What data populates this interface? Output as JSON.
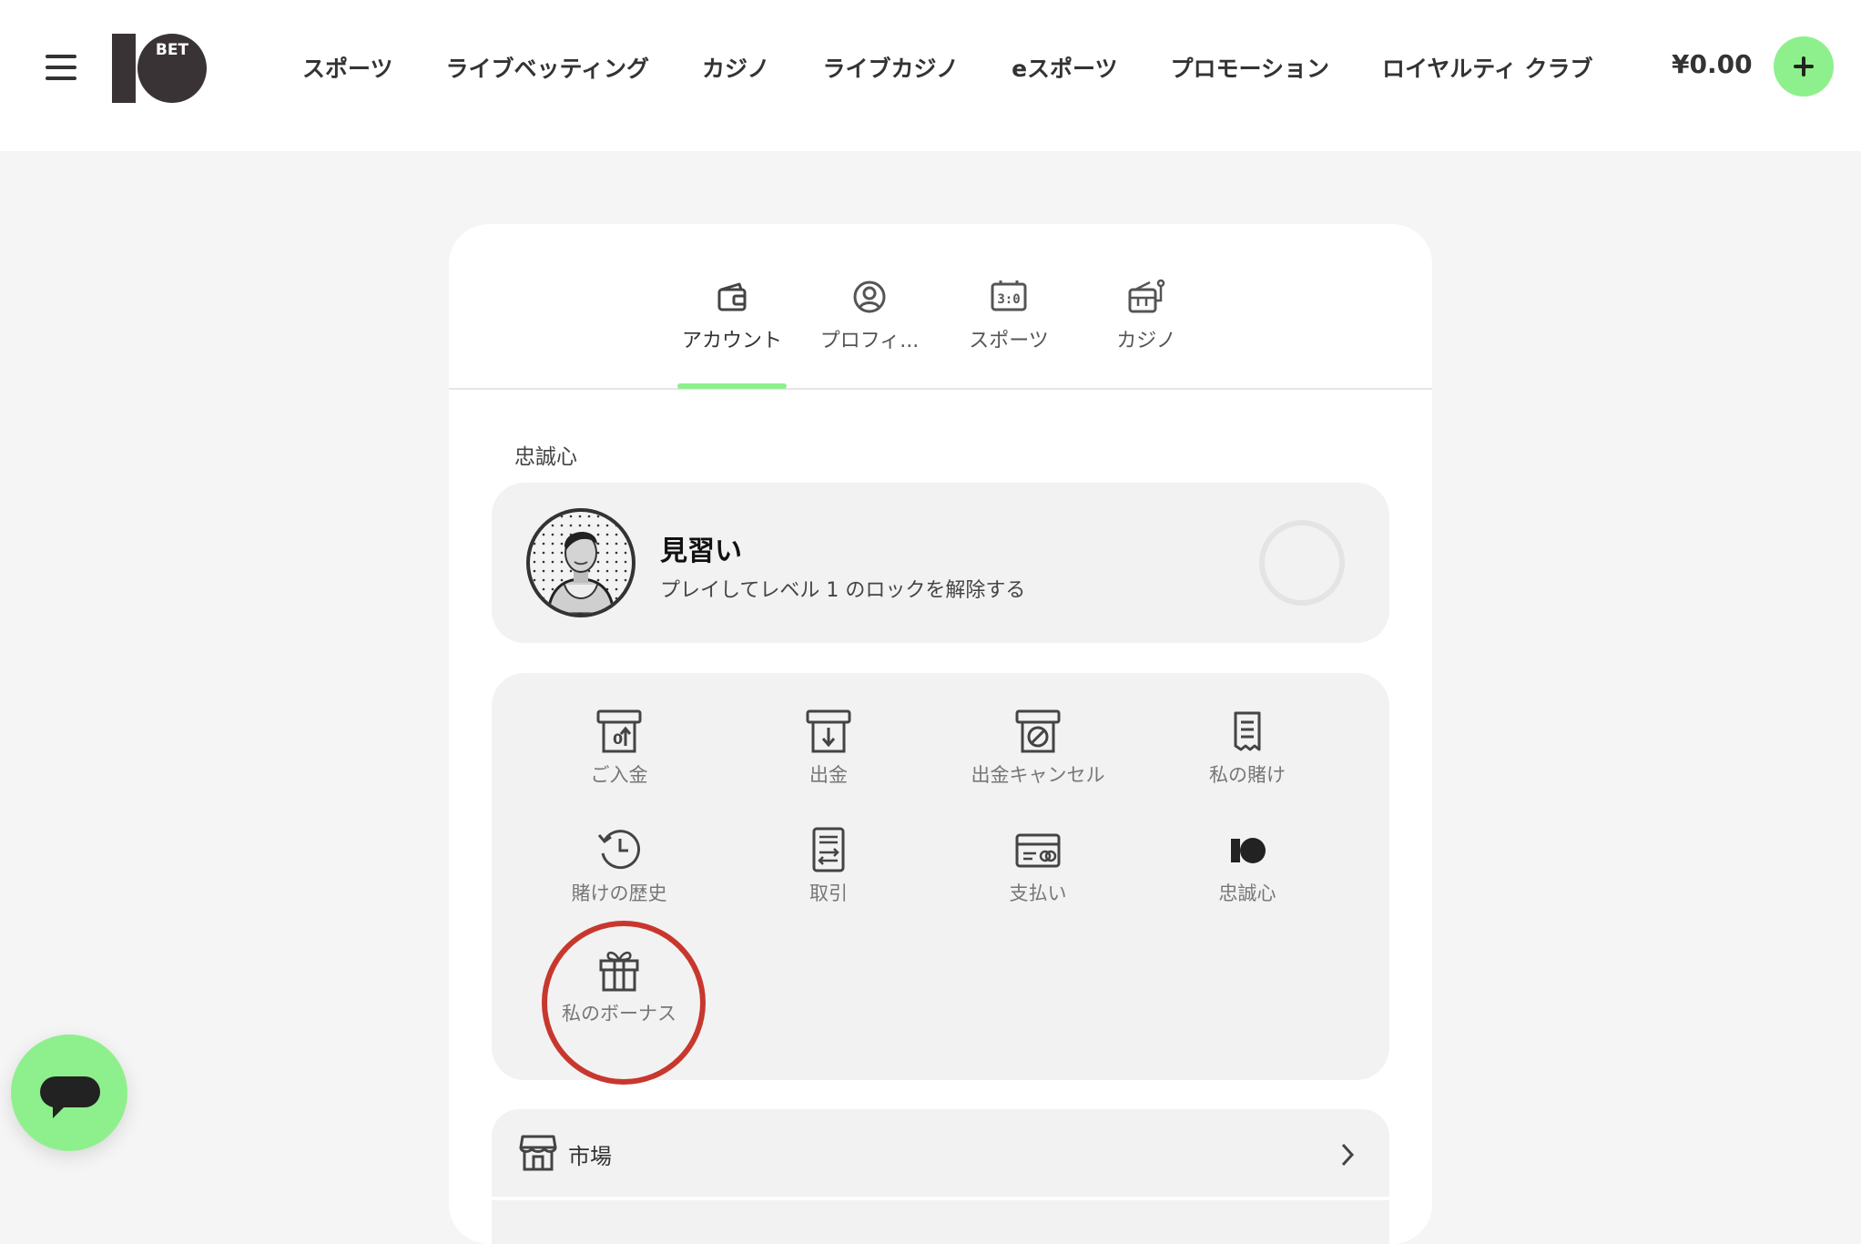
{
  "header": {
    "nav": [
      "スポーツ",
      "ライブベッティング",
      "カジノ",
      "ライブカジノ",
      "eスポーツ",
      "プロモーション",
      "ロイヤルティ クラブ"
    ],
    "balance": "¥0.00",
    "logo_text": [
      "10",
      "BET"
    ]
  },
  "tabs": [
    {
      "label": "アカウント",
      "icon": "wallet-icon",
      "active": true
    },
    {
      "label": "プロフィ...",
      "icon": "user-circle-icon",
      "active": false
    },
    {
      "label": "スポーツ",
      "icon": "scoreboard-icon",
      "score": "3:0",
      "active": false
    },
    {
      "label": "カジノ",
      "icon": "slot-machine-icon",
      "active": false
    }
  ],
  "loyalty": {
    "section_title": "忠誠心",
    "level_name": "見習い",
    "description": "プレイしてレベル 1 のロックを解除する"
  },
  "actions": [
    {
      "label": "ご入金",
      "icon": "deposit-icon"
    },
    {
      "label": "出金",
      "icon": "withdraw-icon"
    },
    {
      "label": "出金キャンセル",
      "icon": "cancel-withdrawal-icon"
    },
    {
      "label": "私の賭け",
      "icon": "receipt-icon"
    },
    {
      "label": "賭けの歴史",
      "icon": "history-icon"
    },
    {
      "label": "取引",
      "icon": "transactions-icon"
    },
    {
      "label": "支払い",
      "icon": "payment-card-icon"
    },
    {
      "label": "忠誠心",
      "icon": "loyalty-logo-icon"
    },
    {
      "label": "私のボーナス",
      "icon": "gift-icon",
      "highlighted": true
    }
  ],
  "market": {
    "label": "市場",
    "icon": "store-icon"
  },
  "colors": {
    "accent": "#8ef08c",
    "highlight": "#c8372d",
    "panel": "#f2f2f2"
  }
}
